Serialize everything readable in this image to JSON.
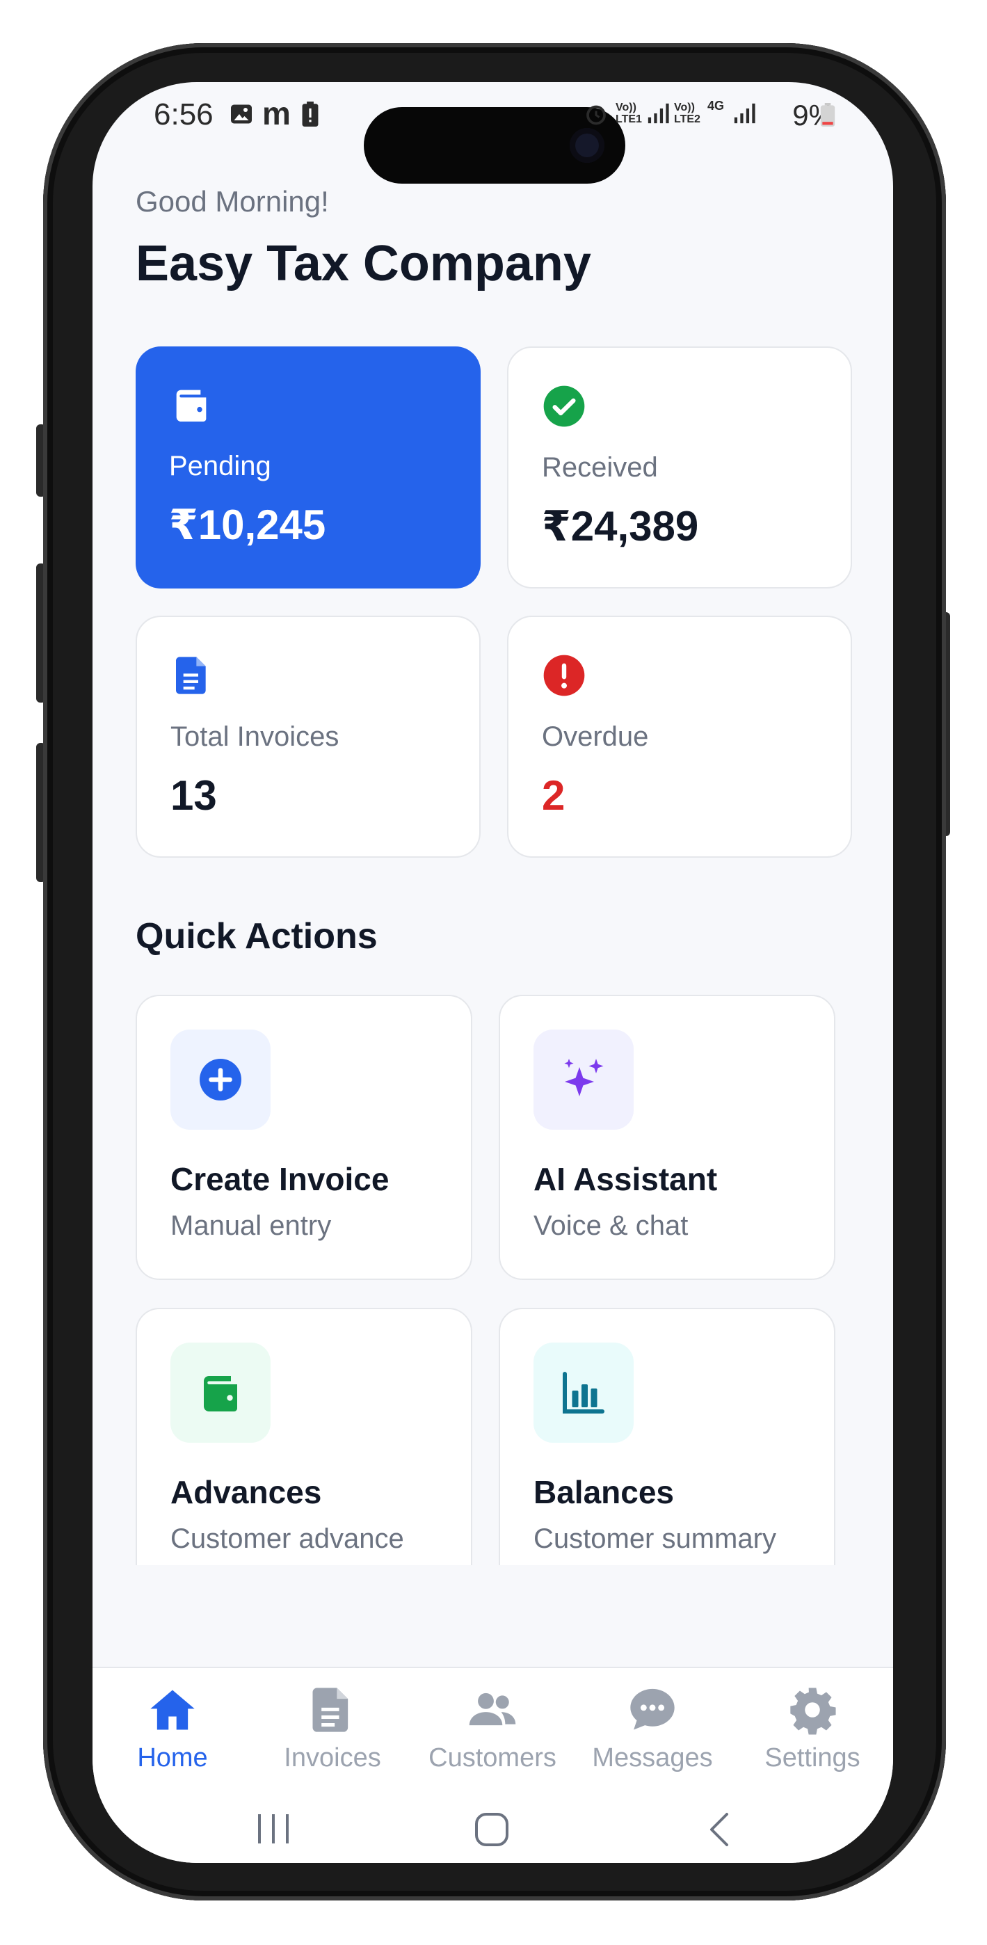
{
  "status_bar": {
    "time": "6:56",
    "network_1": "Vo)) LTE1",
    "network_2": "Vo)) LTE2",
    "network_3": "4G",
    "battery": "9%"
  },
  "header": {
    "greeting": "Good Morning!",
    "company": "Easy Tax Company"
  },
  "stats": [
    {
      "label": "Pending",
      "value": "₹10,245",
      "icon": "wallet-icon"
    },
    {
      "label": "Received",
      "value": "₹24,389",
      "icon": "check-circle-icon",
      "color": "#16a34a"
    },
    {
      "label": "Total Invoices",
      "value": "13",
      "icon": "document-icon",
      "color": "#2563eb"
    },
    {
      "label": "Overdue",
      "value": "2",
      "icon": "alert-circle-icon",
      "color": "#dc2626"
    }
  ],
  "quick_actions": {
    "title": "Quick Actions",
    "items": [
      {
        "title": "Create Invoice",
        "subtitle": "Manual entry",
        "icon": "plus-circle-icon",
        "color": "#2563eb"
      },
      {
        "title": "AI Assistant",
        "subtitle": "Voice & chat",
        "icon": "sparkles-icon",
        "color": "#7c3aed"
      },
      {
        "title": "Advances",
        "subtitle": "Customer advance",
        "icon": "wallet-icon",
        "color": "#16a34a"
      },
      {
        "title": "Balances",
        "subtitle": "Customer summary",
        "icon": "bar-chart-icon",
        "color": "#0e7490"
      }
    ]
  },
  "bottom_nav": [
    {
      "label": "Home",
      "icon": "home-icon",
      "active": true
    },
    {
      "label": "Invoices",
      "icon": "document-icon"
    },
    {
      "label": "Customers",
      "icon": "users-icon"
    },
    {
      "label": "Messages",
      "icon": "chat-icon"
    },
    {
      "label": "Settings",
      "icon": "gear-icon"
    }
  ],
  "theme": {
    "accent": "#2563eb",
    "danger": "#dc2626",
    "success": "#16a34a",
    "inactive": "#9ca3af"
  }
}
